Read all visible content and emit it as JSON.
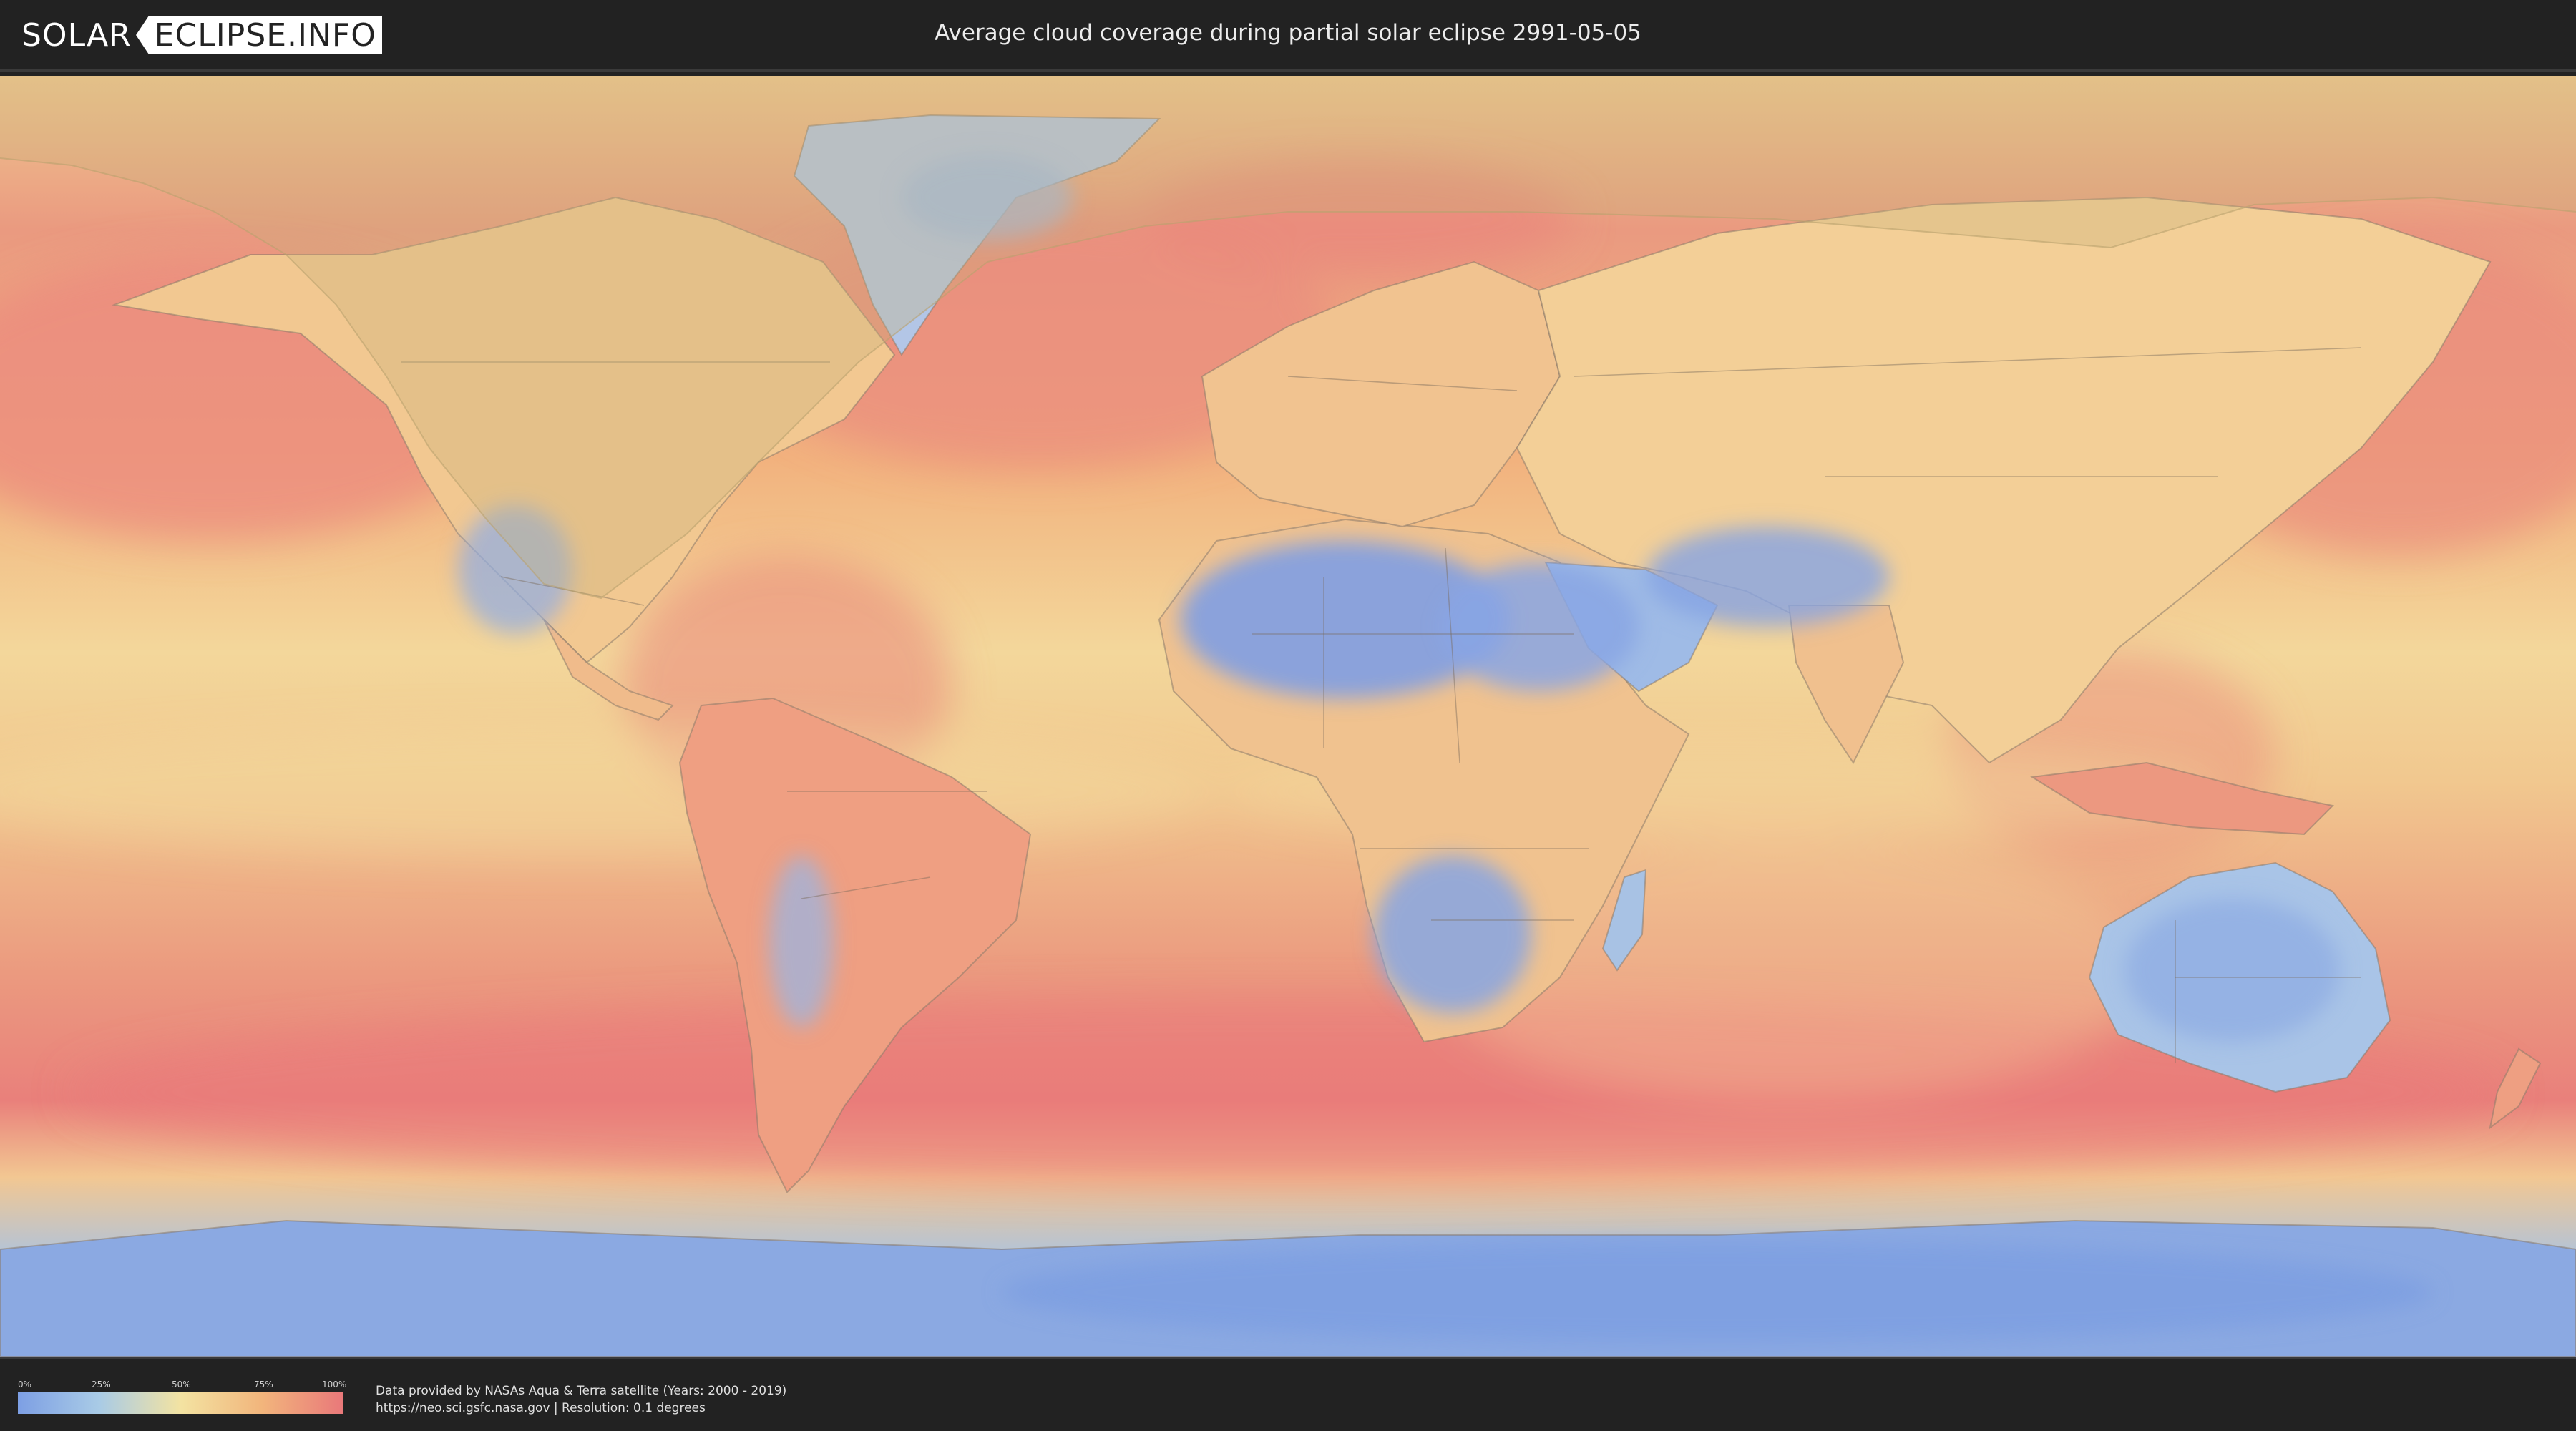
{
  "header": {
    "logo_left": "SOLAR",
    "logo_right": "ECLIPSE.INFO",
    "title": "Average cloud coverage during partial solar eclipse 2991-05-05"
  },
  "legend": {
    "ticks": [
      "0%",
      "25%",
      "50%",
      "75%",
      "100%"
    ],
    "colors": [
      "#7d9fe4",
      "#a9cbe6",
      "#f3e3a2",
      "#f2b57c",
      "#e9787a"
    ]
  },
  "footer": {
    "credit_line": "Data provided by NASAs Aqua & Terra satellite (Years: 2000 - 2019)",
    "source_line": "https://neo.sci.gsfc.nasa.gov | Resolution: 0.1 degrees"
  },
  "map": {
    "layers": [
      "cloud-coverage-heatmap",
      "country-borders",
      "eclipse-visibility-zone"
    ]
  }
}
